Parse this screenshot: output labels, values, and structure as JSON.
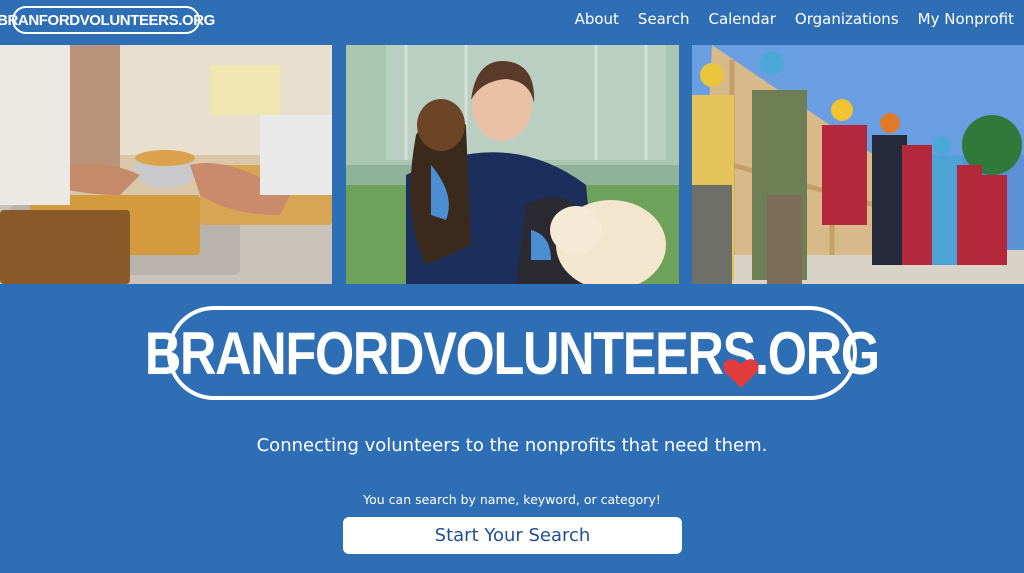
{
  "header": {
    "logo_text": "BRANFORDVOLUNTEERS.ORG",
    "nav": [
      "About",
      "Search",
      "Calendar",
      "Organizations",
      "My Nonprofit"
    ]
  },
  "hero": {
    "photos": [
      {
        "name": "food-serving-photo"
      },
      {
        "name": "animal-shelter-photo"
      },
      {
        "name": "house-building-photo"
      }
    ],
    "logo_text": "BRANFORDVOLUNTEERS.ORG",
    "tagline": "Connecting volunteers to the nonprofits that need them.",
    "hint": "You can search by name, keyword, or category!",
    "cta_label": "Start Your Search"
  },
  "colors": {
    "background": "#2e6eb5",
    "heart": "#e23b3b",
    "button_text": "#1f4f8f"
  }
}
